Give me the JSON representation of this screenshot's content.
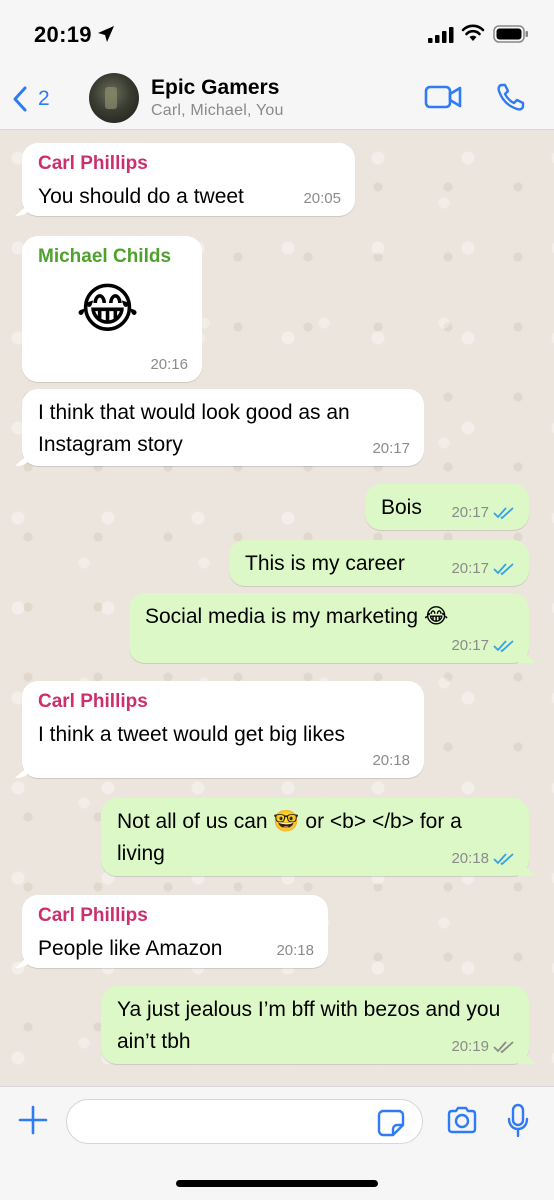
{
  "status_bar": {
    "time": "20:19"
  },
  "header": {
    "back_count": "2",
    "title": "Epic Gamers",
    "subtitle": "Carl, Michael, You",
    "accent_color": "#2f7bf5"
  },
  "messages": [
    {
      "direction": "in",
      "sender": "Carl Phillips",
      "text": "You should do a tweet",
      "time": "20:05"
    },
    {
      "direction": "in",
      "sender": "Michael Childs",
      "text": "😂",
      "time": "20:16"
    },
    {
      "direction": "in",
      "sender": "",
      "text": "I think that would look good as an Instagram story",
      "time": "20:17"
    },
    {
      "direction": "out",
      "text": "Bois",
      "time": "20:17",
      "status": "read"
    },
    {
      "direction": "out",
      "text": "This is my career",
      "time": "20:17",
      "status": "read"
    },
    {
      "direction": "out",
      "text": "Social media is my marketing 😂",
      "time": "20:17",
      "status": "read"
    },
    {
      "direction": "in",
      "sender": "Carl Phillips",
      "text": "I think a tweet would get big likes",
      "time": "20:18"
    },
    {
      "direction": "out",
      "text": "Not all of us can 🤓 or <b> </b> for a living",
      "time": "20:18",
      "status": "read"
    },
    {
      "direction": "in",
      "sender": "Carl Phillips",
      "text": "People like Amazon",
      "time": "20:18"
    },
    {
      "direction": "out",
      "text": "Ya just jealous I’m bff with bezos and you ain’t tbh",
      "time": "20:19",
      "status": "delivered"
    }
  ],
  "colors": {
    "incoming_bubble": "#ffffff",
    "outgoing_bubble": "#dcf8c6",
    "carl_name": "#cc2f6e",
    "michael_name": "#4ea12f",
    "read_ticks": "#34a2e8",
    "delivered_ticks": "#8b8b8b"
  },
  "input": {
    "placeholder": "",
    "value": ""
  },
  "icons": {
    "location": "location-arrow-icon",
    "signal": "cellular-signal-icon",
    "wifi": "wifi-icon",
    "battery": "battery-icon",
    "back": "chevron-left-icon",
    "video": "video-call-icon",
    "call": "phone-icon",
    "plus": "plus-icon",
    "sticker": "sticker-icon",
    "camera": "camera-icon",
    "mic": "microphone-icon"
  }
}
